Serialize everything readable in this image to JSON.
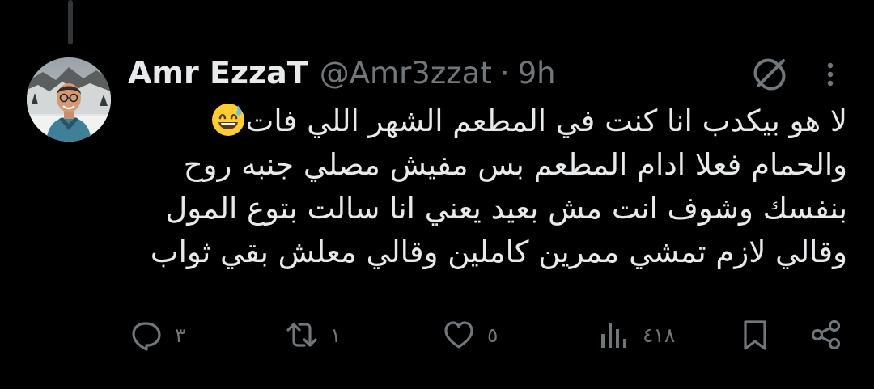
{
  "tweet": {
    "author": {
      "display_name": "Amr EzzaT",
      "handle": "@Amr3zzat",
      "avatar": "avatar"
    },
    "separator": "·",
    "time": "9h",
    "text_lines": [
      "لا هو بيكدب انا كنت في المطعم الشهر اللي فات",
      "والحمام فعلا ادام المطعم بس مفيش مصلي جنبه روح",
      "بنفسك وشوف انت مش بعيد يعني انا سالت بتوع المول",
      "وقالي لازم تمشي ممرين كاملين وقالي معلش بقي ثواب"
    ],
    "emoji": "grinning-face-with-sweat",
    "icons": {
      "header_left": "grok-icon",
      "header_right": "more-icon"
    }
  },
  "actions": {
    "reply": {
      "icon": "reply-icon",
      "count": "٣"
    },
    "retweet": {
      "icon": "retweet-icon",
      "count": "١"
    },
    "like": {
      "icon": "like-icon",
      "count": "٥"
    },
    "views": {
      "icon": "views-icon",
      "count": "٤١٨"
    },
    "bookmark": {
      "icon": "bookmark-icon"
    },
    "share": {
      "icon": "share-icon"
    }
  },
  "colors": {
    "background": "#000000",
    "text": "#e7e9ea",
    "secondary": "#71767b",
    "thread_line": "#333639"
  }
}
